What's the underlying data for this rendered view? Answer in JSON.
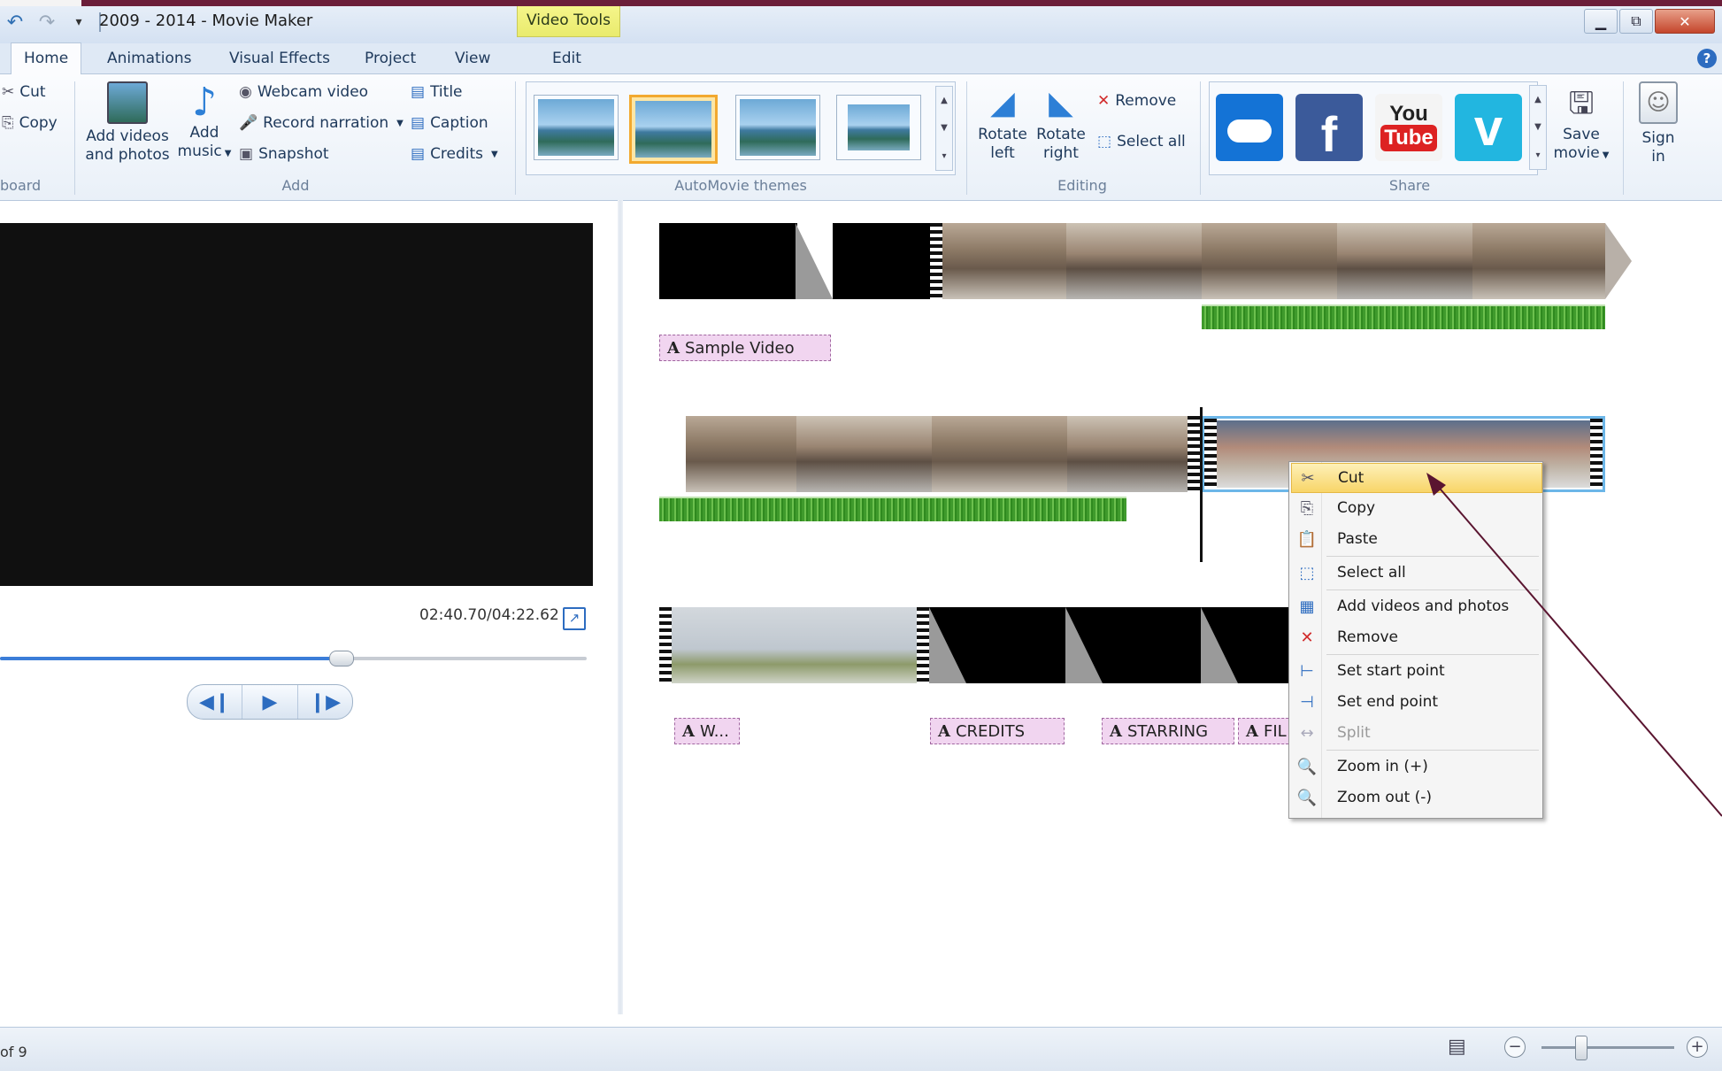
{
  "window": {
    "title": "2009 - 2014 - Movie Maker",
    "context_tab": "Video Tools"
  },
  "tabs": [
    "Home",
    "Animations",
    "Visual Effects",
    "Project",
    "View",
    "Edit"
  ],
  "active_tab": "Home",
  "ribbon": {
    "clipboard": {
      "cut": "Cut",
      "copy": "Copy",
      "group": "board"
    },
    "add": {
      "add_videos_line1": "Add videos",
      "add_videos_line2": "and photos",
      "add_music_line1": "Add",
      "add_music_line2": "music",
      "webcam": "Webcam video",
      "narration": "Record narration",
      "snapshot": "Snapshot",
      "title": "Title",
      "caption": "Caption",
      "credits": "Credits",
      "group": "Add"
    },
    "themes_group": "AutoMovie themes",
    "editing": {
      "rotate_left_1": "Rotate",
      "rotate_left_2": "left",
      "rotate_right_1": "Rotate",
      "rotate_right_2": "right",
      "remove": "Remove",
      "select_all": "Select all",
      "group": "Editing"
    },
    "share": {
      "youtube_1": "You",
      "youtube_2": "Tube",
      "save_movie_1": "Save",
      "save_movie_2": "movie",
      "sign_in_1": "Sign",
      "sign_in_2": "in",
      "group": "Share"
    }
  },
  "preview": {
    "timecode": "02:40.70/04:22.62",
    "seek_fraction": 0.58
  },
  "storyboard": {
    "captions": {
      "sample_video": "Sample Video",
      "w": "W...",
      "credits": "CREDITS",
      "starring": "STARRING",
      "fil": "FIL"
    }
  },
  "context_menu": {
    "items": [
      {
        "label": "Cut",
        "icon": "scissors-icon",
        "state": "hover"
      },
      {
        "label": "Copy",
        "icon": "copy-icon"
      },
      {
        "label": "Paste",
        "icon": "paste-icon"
      },
      {
        "label": "Select all",
        "icon": "select-all-icon"
      },
      {
        "label": "Add videos and photos",
        "icon": "add-media-icon"
      },
      {
        "label": "Remove",
        "icon": "remove-icon"
      },
      {
        "label": "Set start point",
        "icon": "start-point-icon"
      },
      {
        "label": "Set end point",
        "icon": "end-point-icon"
      },
      {
        "label": "Split",
        "icon": "split-icon",
        "state": "disabled"
      },
      {
        "label": "Zoom in (+)",
        "icon": "zoom-in-icon"
      },
      {
        "label": "Zoom out (-)",
        "icon": "zoom-out-icon"
      }
    ]
  },
  "status": {
    "item_count": "of 9"
  },
  "colors": {
    "accent": "#2d6cc0",
    "context_tab": "#f5f58a",
    "menu_hover": "#f8d568",
    "annotation_arrow": "#5a1530"
  }
}
